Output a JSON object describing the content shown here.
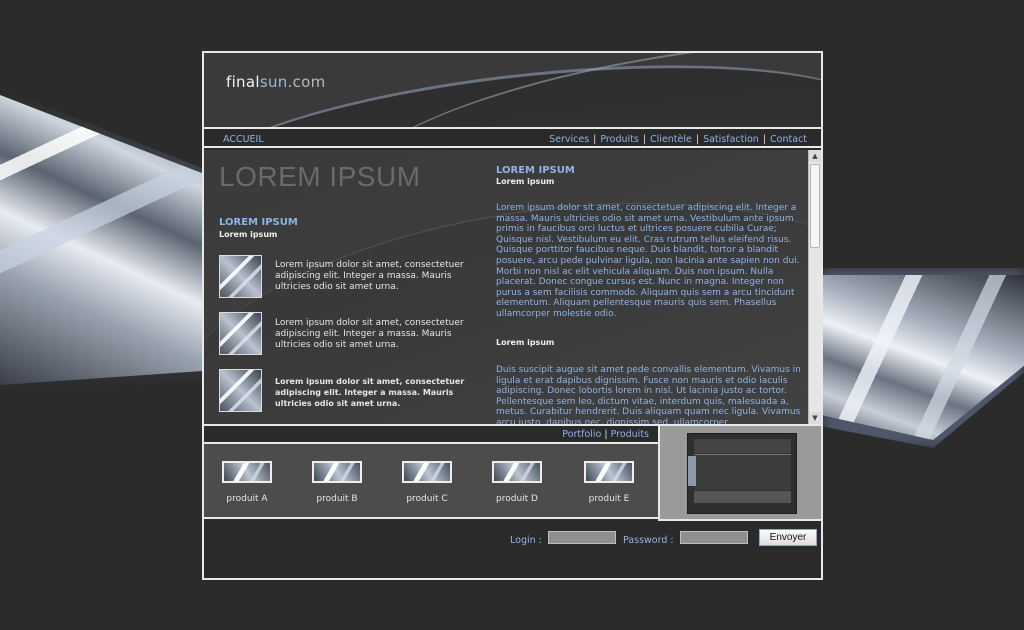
{
  "logo": {
    "part1": "final",
    "part2": "sun",
    "part3": ".com"
  },
  "nav": {
    "home": "ACCUEIL",
    "links": [
      "Services",
      "Produits",
      "Clientèle",
      "Satisfaction",
      "Contact"
    ],
    "separator": "|"
  },
  "main": {
    "big_title": "LOREM IPSUM",
    "left_title": "LOREM IPSUM",
    "left_subtitle": "Lorem ipsum",
    "items": [
      {
        "text": "Lorem ipsum dolor sit amet, consectetuer adipiscing elit. Integer a massa. Mauris ultricies odio sit amet urna."
      },
      {
        "text": "Lorem ipsum dolor sit amet, consectetuer adipiscing elit. Integer a massa. Mauris ultricies odio sit amet urna."
      },
      {
        "text": "Lorem ipsum dolor sit amet, consectetuer adipiscing elit. Integer a massa. Mauris ultricies odio sit amet urna."
      }
    ],
    "right_title": "LOREM IPSUM",
    "right_subtitle": "Lorem ipsum",
    "right_paragraph1": "Lorem ipsum dolor sit amet, consectetuer adipiscing elit. Integer a massa. Mauris ultricies odio sit amet urna. Vestibulum ante ipsum primis in faucibus orci luctus et ultrices posuere cubilia Curae; Quisque nisl. Vestibulum eu elit. Cras rutrum tellus eleifend risus. Quisque porttitor faucibus neque. Duis blandit, tortor a blandit posuere, arcu pede pulvinar ligula, non lacinia ante sapien non dui. Morbi non nisl ac elit vehicula aliquam. Duis non ipsum. Nulla placerat. Donec congue cursus est. Nunc in magna. Integer non purus a sem facilisis commodo. Aliquam quis sem a arcu tincidunt elementum. Aliquam pellentesque mauris quis sem. Phasellus ullamcorper molestie odio.",
    "right_subtitle2": "Lorem ipsum",
    "right_paragraph2": "Duis suscipit augue sit amet pede convallis elementum. Vivamus in ligula et erat dapibus dignissim. Fusce non mauris et odio iaculis adipiscing. Donec lobortis lorem in nisl. Ut lacinia justo ac tortor. Pellentesque sem leo, dictum vitae, interdum quis, malesuada a, metus. Curabitur hendrerit. Duis aliquam quam nec ligula. Vivamus arcu justo, dapibus nec, dignissim sed, ullamcorper."
  },
  "portfolio_bar": {
    "link1": "Portfolio",
    "link2": "Produits",
    "separator": "|"
  },
  "products": [
    "produit A",
    "produit B",
    "produit C",
    "produit D",
    "produit E"
  ],
  "login": {
    "login_label": "Login :",
    "password_label": "Password :",
    "login_value": "",
    "password_value": "",
    "submit_label": "Envoyer"
  },
  "colors": {
    "accent": "#8fb4e6",
    "frame": "#e8e8e8",
    "background": "#2b2b2b"
  }
}
